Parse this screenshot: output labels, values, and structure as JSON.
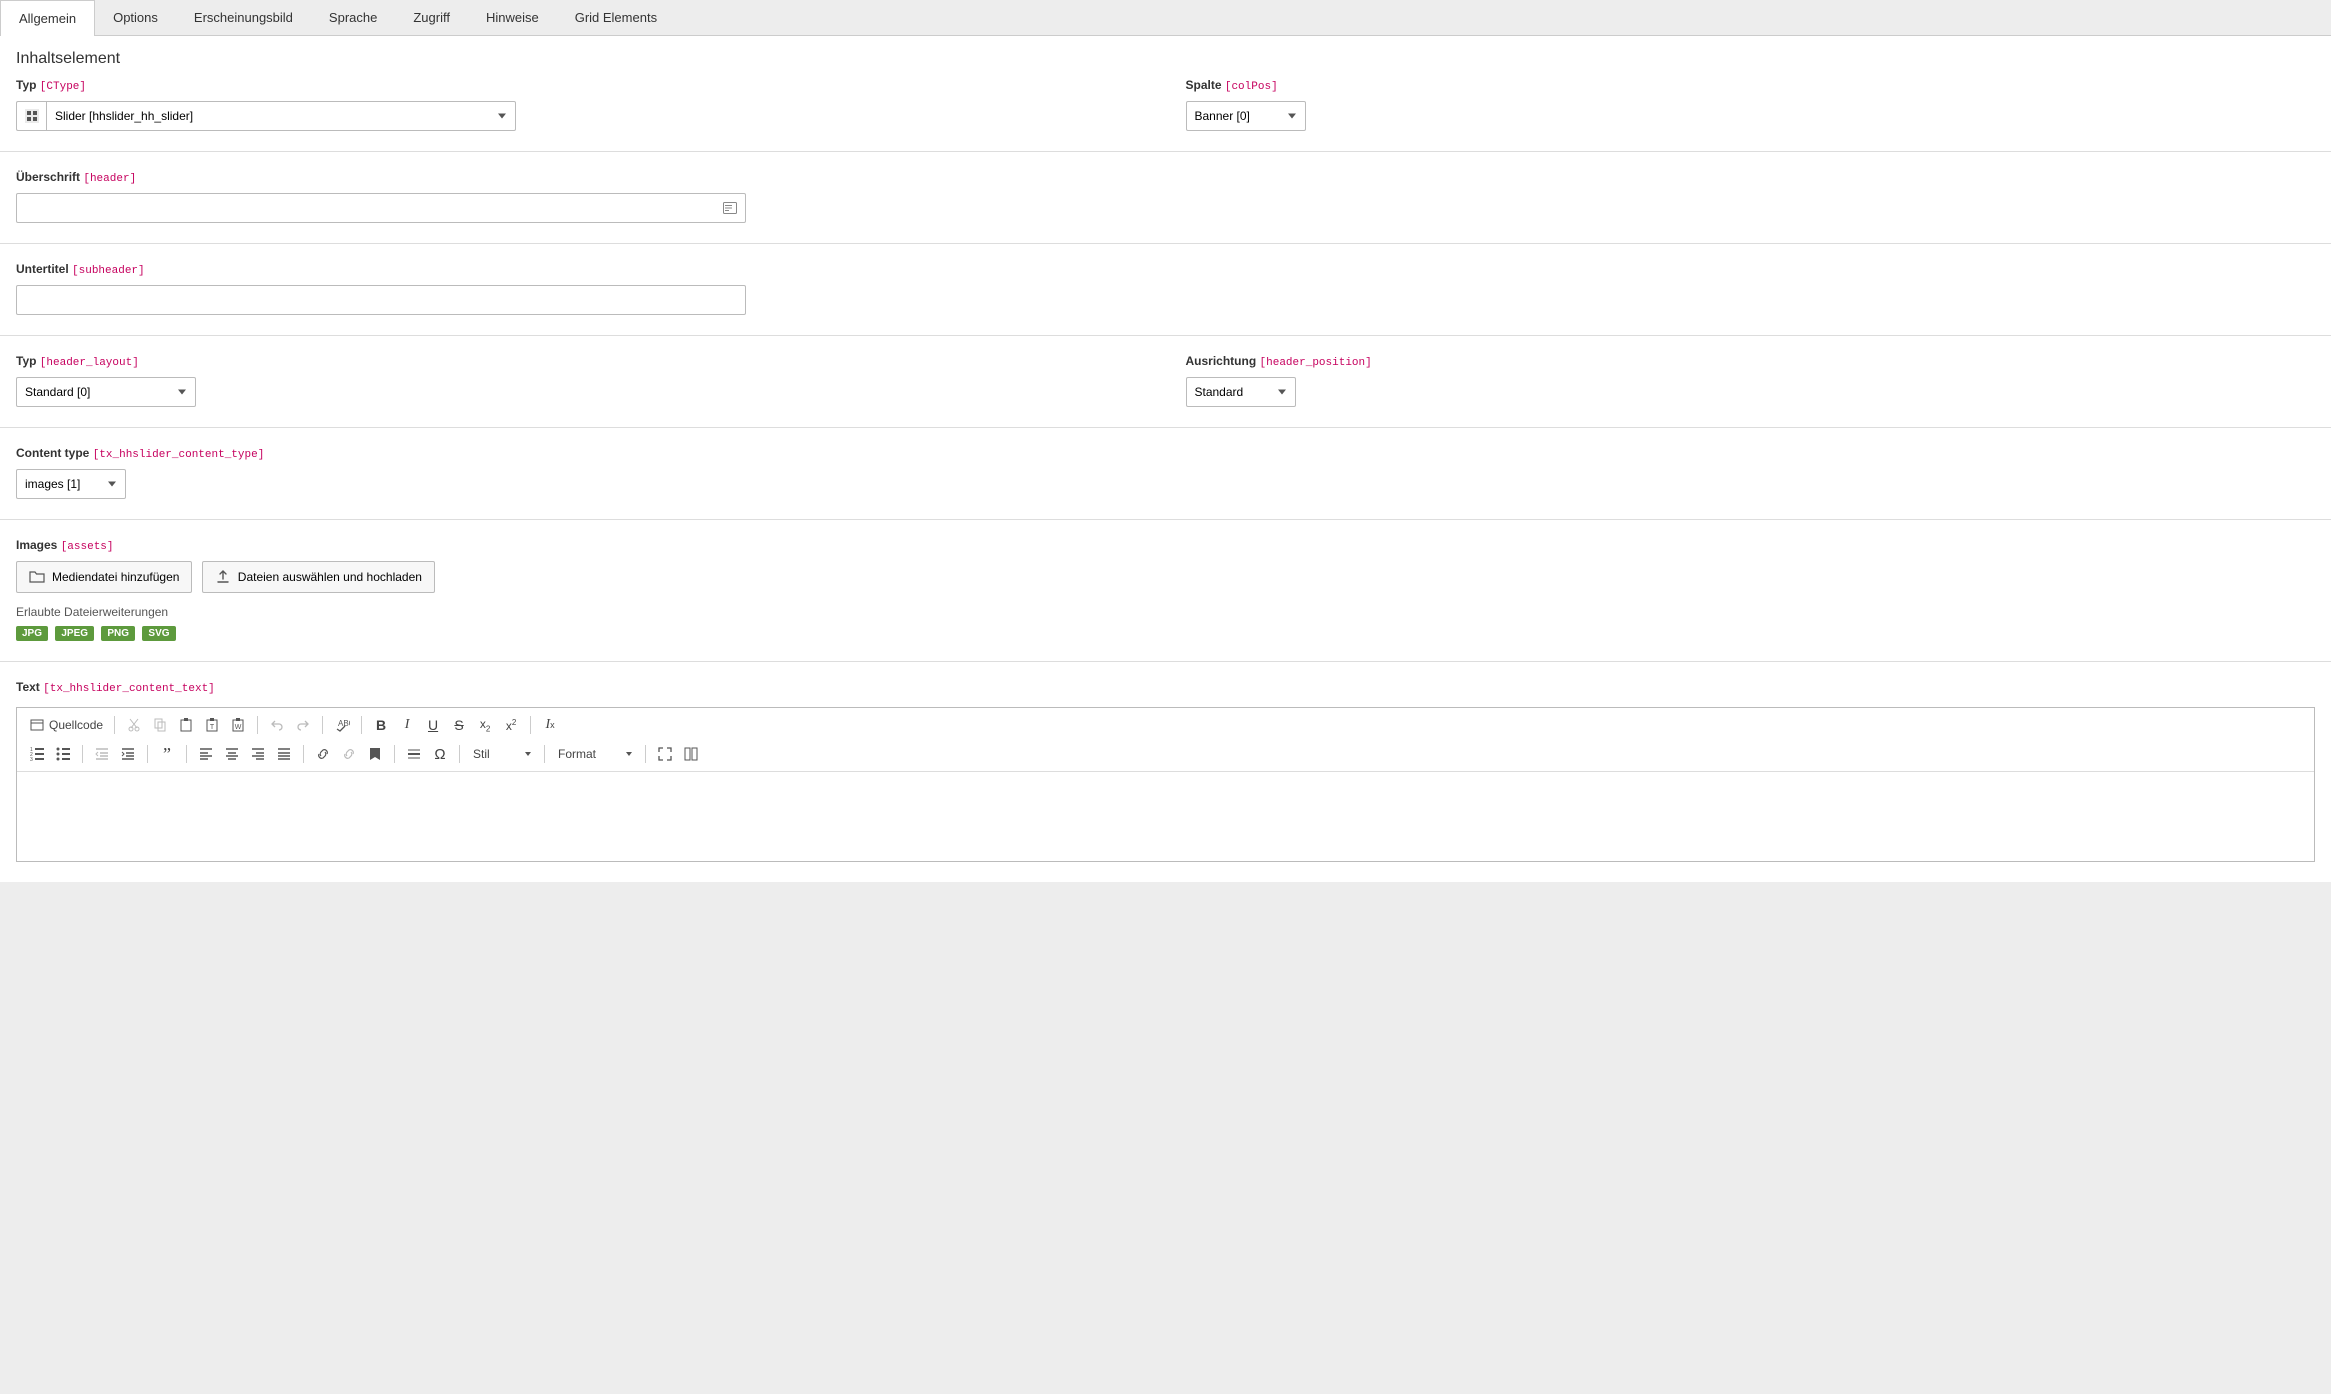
{
  "tabs": [
    {
      "label": "Allgemein",
      "active": true
    },
    {
      "label": "Options"
    },
    {
      "label": "Erscheinungsbild"
    },
    {
      "label": "Sprache"
    },
    {
      "label": "Zugriff"
    },
    {
      "label": "Hinweise"
    },
    {
      "label": "Grid Elements"
    }
  ],
  "section_title": "Inhaltselement",
  "fields": {
    "ctype": {
      "label": "Typ",
      "code": "[CType]",
      "value": "Slider [hhslider_hh_slider]"
    },
    "colpos": {
      "label": "Spalte",
      "code": "[colPos]",
      "value": "Banner [0]"
    },
    "header": {
      "label": "Überschrift",
      "code": "[header]",
      "value": ""
    },
    "subheader": {
      "label": "Untertitel",
      "code": "[subheader]",
      "value": ""
    },
    "header_layout": {
      "label": "Typ",
      "code": "[header_layout]",
      "value": "Standard [0]"
    },
    "header_position": {
      "label": "Ausrichtung",
      "code": "[header_position]",
      "value": "Standard"
    },
    "content_type": {
      "label": "Content type",
      "code": "[tx_hhslider_content_type]",
      "value": "images [1]"
    },
    "assets": {
      "label": "Images",
      "code": "[assets]",
      "btn_add": "Mediendatei hinzufügen",
      "btn_upload": "Dateien auswählen und hochladen",
      "allowed_label": "Erlaubte Dateierweiterungen",
      "allowed": [
        "JPG",
        "JPEG",
        "PNG",
        "SVG"
      ]
    },
    "text": {
      "label": "Text",
      "code": "[tx_hhslider_content_text]"
    }
  },
  "rte": {
    "source_label": "Quellcode",
    "combo_style": "Stil",
    "combo_format": "Format"
  }
}
